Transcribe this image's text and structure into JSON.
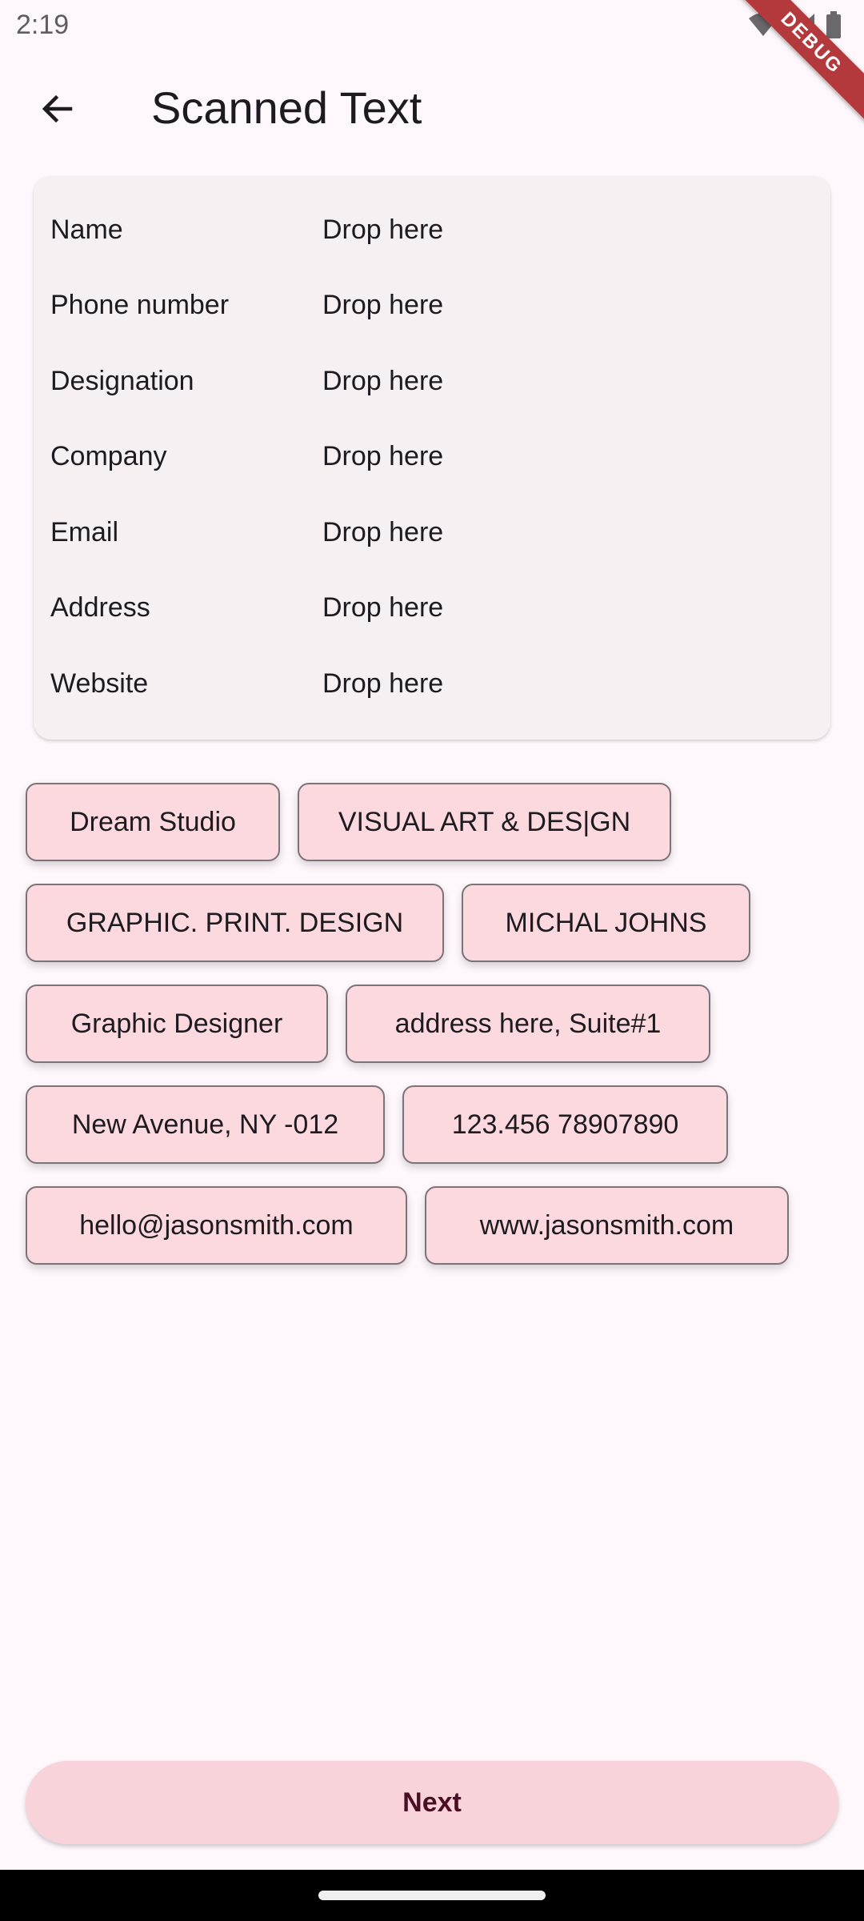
{
  "status_bar": {
    "time": "2:19",
    "icons": [
      "wifi-icon",
      "cellular-signal-icon",
      "battery-icon"
    ]
  },
  "debug_banner": "DEBUG",
  "app_bar": {
    "back_icon": "arrow-back-icon",
    "title": "Scanned Text"
  },
  "fields": [
    {
      "label": "Name",
      "value": "Drop here"
    },
    {
      "label": "Phone number",
      "value": "Drop here"
    },
    {
      "label": "Designation",
      "value": "Drop here"
    },
    {
      "label": "Company",
      "value": "Drop here"
    },
    {
      "label": "Email",
      "value": "Drop here"
    },
    {
      "label": "Address",
      "value": "Drop here"
    },
    {
      "label": "Website",
      "value": "Drop here"
    }
  ],
  "chips": [
    "Dream Studio",
    "VISUAL ART & DES|GN",
    "GRAPHIC. PRINT. DESIGN",
    "MICHAL JOHNS",
    "Graphic Designer",
    "address here, Suite#1",
    "New Avenue, NY -012",
    "123.456 78907890",
    "hello@jasonsmith.com",
    "www.jasonsmith.com"
  ],
  "next_button": {
    "label": "Next"
  },
  "colors": {
    "background": "#fef7fb",
    "card": "#f7f0f3",
    "chip": "#fcd9de",
    "chip_border": "#7c7378",
    "button": "#f8d3d9",
    "button_text": "#4a0f24",
    "debug_ribbon": "#b3393c"
  }
}
